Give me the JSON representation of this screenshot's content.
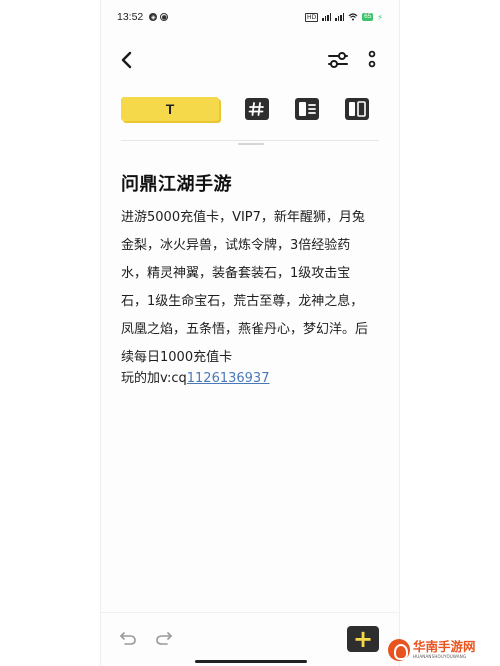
{
  "status_bar": {
    "time": "13:52",
    "battery": "65"
  },
  "format_toolbar": {
    "text_label": "T"
  },
  "note": {
    "title": "问鼎江湖手游",
    "body": "进游5000充值卡，VIP7，新年醒狮，月兔\n金梨，冰火异兽，试炼令牌，3倍经验药\n水，精灵神翼，装备套装石，1级攻击宝\n石，1级生命宝石，荒古至尊，龙神之息，\n凤凰之焰，五条悟，燕雀丹心，梦幻洋。后\n续每日1000充值卡",
    "contact_prefix": "玩的加v:cq",
    "contact_number": "1126136937"
  },
  "bottom_bar": {
    "add_label": "+"
  },
  "watermark": {
    "name": "华南手游网",
    "subtitle": "HUANANSHOUYOUWANG"
  },
  "colors": {
    "accent_yellow": "#f5d94a",
    "link_blue": "#4a79b8",
    "dark_button": "#2e2e2e",
    "battery_green": "#3cc46a",
    "watermark_orange": "#e8541f"
  },
  "icons": [
    "back-arrow-icon",
    "tune-icon",
    "more-vertical-icon",
    "hashtag-icon",
    "list-icon",
    "split-view-icon",
    "undo-icon",
    "redo-icon",
    "plus-icon"
  ]
}
